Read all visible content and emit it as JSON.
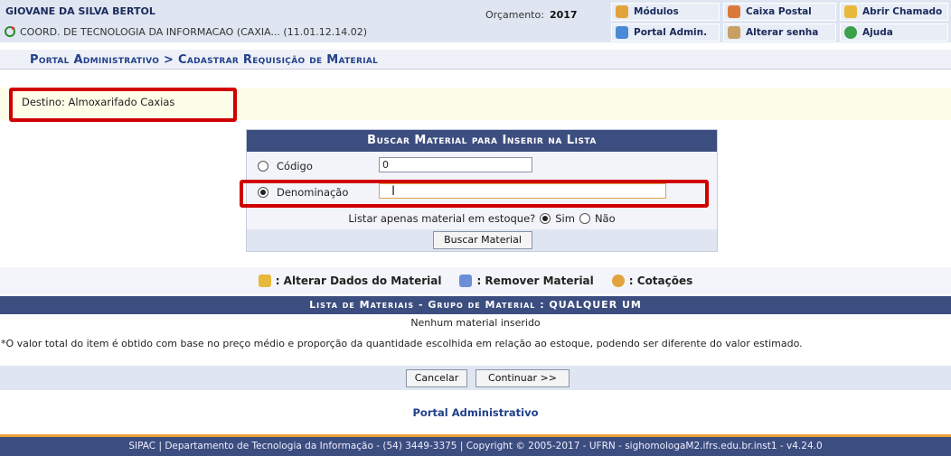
{
  "header": {
    "user_name": "GIOVANE DA SILVA BERTOL",
    "unit": "COORD. DE TECNOLOGIA DA INFORMACAO (CAXIA... (11.01.12.14.02)",
    "orcamento_label": "Orçamento:",
    "orcamento_year": "2017",
    "menu": {
      "modulos": "Módulos",
      "caixa_postal": "Caixa Postal",
      "abrir_chamado": "Abrir Chamado",
      "portal_admin": "Portal Admin.",
      "alterar_senha": "Alterar senha",
      "ajuda": "Ajuda"
    }
  },
  "page_title": "Portal Administrativo > Cadastrar Requisição de Material",
  "destino": "Destino: Almoxarifado Caxias",
  "search_form": {
    "heading": "Buscar Material para Inserir na Lista",
    "codigo_label": "Código",
    "codigo_value": "0",
    "denominacao_label": "Denominação",
    "denominacao_value": "",
    "estoque_question": "Listar apenas material em estoque?",
    "sim_label": "Sim",
    "nao_label": "Não",
    "selected_option": "Denominação",
    "estoque_selected": "Sim",
    "search_button": "Buscar Material"
  },
  "legend": {
    "alterar": ": Alterar Dados do Material",
    "remover": ": Remover Material",
    "cotacoes": ": Cotações"
  },
  "list": {
    "heading": "Lista de Materiais - Grupo de Material : QUALQUER UM",
    "empty_message": "Nenhum material inserido",
    "note": "*O valor total do item é obtido com base no preço médio e proporção da quantidade escolhida em relação ao estoque, podendo ser diferente do valor estimado."
  },
  "actions": {
    "cancel": "Cancelar",
    "continue": "Continuar >>"
  },
  "portal_link": "Portal Administrativo",
  "footer": "SIPAC | Departamento de Tecnologia da Informação - (54) 3449-3375 | Copyright © 2005-2017 - UFRN - sighomologaM2.ifrs.edu.br.inst1 - v4.24.0",
  "colors": {
    "header_blue": "#3c4d7f",
    "title_blue": "#22418a",
    "highlight_red": "#d10000",
    "footer_accent": "#e8a23a"
  }
}
